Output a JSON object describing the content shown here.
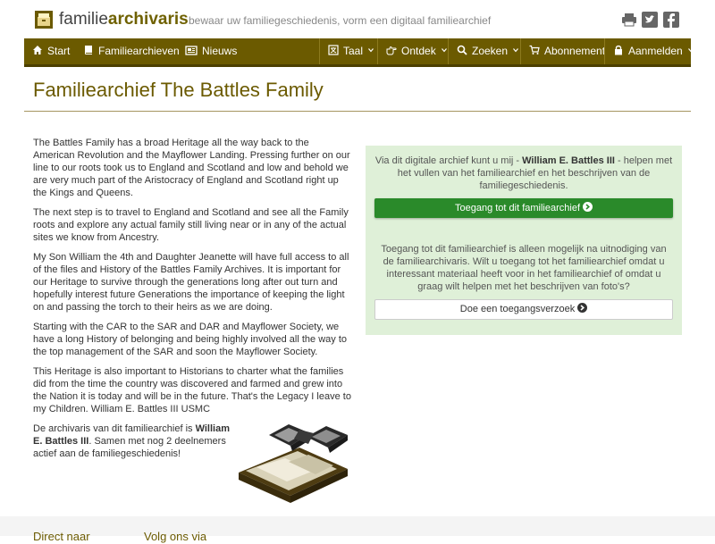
{
  "header": {
    "brand_regular": "familie",
    "brand_bold": "archivaris",
    "tagline": "bewaar uw familiegeschiedenis, vorm een digitaal familiearchief",
    "icons": [
      "printer-icon",
      "twitter-icon",
      "facebook-icon"
    ]
  },
  "nav": {
    "start": "Start",
    "archives": "Familiearchieven",
    "news": "Nieuws",
    "language": "Taal",
    "discover": "Ontdek",
    "search": "Zoeken",
    "subscription": "Abonnement",
    "login": "Aanmelden"
  },
  "page": {
    "title": "Familiearchief The Battles Family"
  },
  "content": {
    "p1": "The Battles Family has a broad Heritage all the way back to the American Revolution and the Mayflower Landing. Pressing further on our line to our roots took us to England and Scotland and low and behold we are very much part of the Aristocracy of England and Scotland right up the Kings and Queens.",
    "p2": "The next step is to travel to England and Scotland and see all the Family roots and explore any actual family still living near or in any of the actual sites we know from Ancestry.",
    "p3": "My Son William the 4th and Daughter Jeanette will have full access to all of the files and History of the Battles Family Archives. It is important for our Heritage to survive through the generations long after out turn and hopefully interest future Generations the importance of keeping the light on and passing the torch to their heirs as we are doing.",
    "p4": "Starting with the CAR to the SAR and DAR and Mayflower Society, we have a long History of belonging and being highly involved all the way to the top management of the SAR and soon the Mayflower Society.",
    "p5": "This Heritage is also important to Historians to charter what the families did from the time the country was discovered and farmed and grew into the Nation it is today and will be in the future. That's the Legacy I leave to my Children. William E. Battles III USMC",
    "archivist_prefix": "De archivaris van dit familiearchief is ",
    "archivist_name": "William E. Battles III",
    "archivist_suffix": ". Samen met nog 2 deelnemers actief aan de familiegeschiedenis!"
  },
  "panel": {
    "intro_prefix": "Via dit digitale archief kunt u mij - ",
    "intro_name": "William E. Battles III",
    "intro_suffix": " - helpen met het vullen van het familiearchief en het beschrijven van de familiegeschiedenis.",
    "access_button": "Toegang tot dit familiearchief",
    "restricted_text": "Toegang tot dit familiearchief is alleen mogelijk na uitnodiging van de familiearchivaris. Wilt u toegang tot het familiearchief omdat u interessant materiaal heeft voor in het familiearchief of omdat u graag wilt helpen met het beschrijven van foto's?",
    "request_button": "Doe een toegangsverzoek"
  },
  "footer": {
    "direct_to": "Direct naar",
    "follow_us": "Volg ons via"
  },
  "colors": {
    "brand": "#6b5a00",
    "panel_bg": "#dff0d8",
    "access_button": "#2a8a2a"
  }
}
